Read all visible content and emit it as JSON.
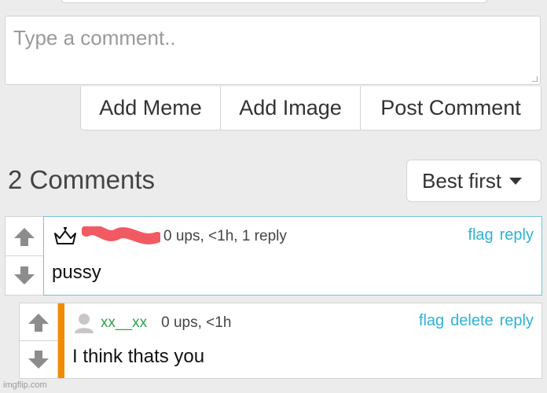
{
  "composer": {
    "placeholder": "Type a comment..",
    "add_meme": "Add Meme",
    "add_image": "Add Image",
    "post_comment": "Post Comment"
  },
  "comments_header": {
    "count_label": "2 Comments",
    "sort_selected": "Best first"
  },
  "comments": [
    {
      "username": "",
      "meta": "0 ups, <1h, 1 reply",
      "text": "pussy",
      "actions": {
        "flag": "flag",
        "reply": "reply"
      }
    },
    {
      "username": "xx__xx",
      "meta": "0 ups, <1h",
      "text": "I think thats you",
      "actions": {
        "flag": "flag",
        "delete": "delete",
        "reply": "reply"
      }
    }
  ],
  "watermark": "imgflip.com",
  "colors": {
    "link": "#2cb3d5",
    "highlight_border": "#6fc6d8",
    "reply_accent": "#f38b00",
    "username_green": "#2ea34a",
    "redaction": "#f25a63"
  },
  "icons": [
    "upvote-arrow-icon",
    "downvote-arrow-icon",
    "crown-icon",
    "default-avatar-icon",
    "caret-down-icon"
  ]
}
